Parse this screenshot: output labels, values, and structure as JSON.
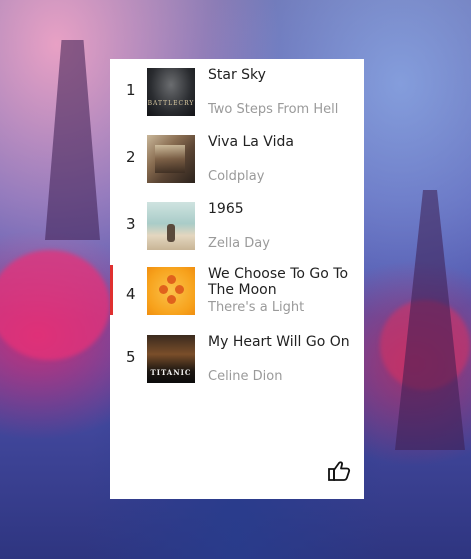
{
  "playlist": {
    "items": [
      {
        "rank": "1",
        "title": "Star Sky",
        "artist": "Two Steps From Hell",
        "cover": "battlecry-album-cover"
      },
      {
        "rank": "2",
        "title": "Viva La Vida",
        "artist": "Coldplay",
        "cover": "viva-la-vida-album-cover"
      },
      {
        "rank": "3",
        "title": "1965",
        "artist": "Zella Day",
        "cover": "zella-day-album-cover"
      },
      {
        "rank": "4",
        "title": "We Choose To Go To The Moon",
        "artist": "There's a Light",
        "cover": "orange-dots-album-cover"
      },
      {
        "rank": "5",
        "title": "My Heart Will Go On",
        "artist": "Celine Dion",
        "cover": "titanic-album-cover"
      }
    ],
    "active_index": 3,
    "cover_text": {
      "battlecry": "BATTLECRY",
      "titanic": "TITANIC"
    }
  },
  "actions": {
    "like_icon": "thumbs-up-icon"
  },
  "colors": {
    "active_indicator": "#e03030",
    "artist_text": "#9a9a9a",
    "title_text": "#222222"
  }
}
